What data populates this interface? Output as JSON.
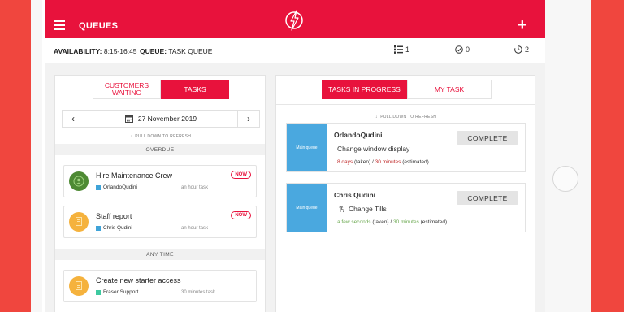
{
  "header": {
    "title": "QUEUES",
    "menu_icon": "hamburger-icon",
    "logo_icon": "lightning-bolt-logo-icon",
    "add_icon": "plus-icon"
  },
  "info": {
    "availability_label": "AVAILABILITY:",
    "availability_value": "8:15-16:45",
    "queue_label": "QUEUE:",
    "queue_value": "TASK QUEUE",
    "stats": [
      {
        "icon": "list-icon",
        "value": "1"
      },
      {
        "icon": "check-circle-icon",
        "value": "0"
      },
      {
        "icon": "clock-icon",
        "value": "2"
      }
    ]
  },
  "left_panel": {
    "tabs": [
      "CUSTOMERS WAITING",
      "TASKS"
    ],
    "active_tab": "TASKS",
    "date": "27 November 2019",
    "pull_refresh": "PULL DOWN TO REFRESH",
    "sections": {
      "overdue": "OVERDUE",
      "any_time": "ANY TIME"
    },
    "tasks": [
      {
        "title": "Hire Maintenance Crew",
        "assignee": "OrlandoQudini",
        "duration": "an hour task",
        "badge": "NOW",
        "icon": "person-icon",
        "color": "#4e8a34",
        "tag_color": "#3fa3d8"
      },
      {
        "title": "Staff report",
        "assignee": "Chris Qudini",
        "duration": "an hour task",
        "badge": "NOW",
        "icon": "document-icon",
        "color": "#f5b23d",
        "tag_color": "#3fa3d8"
      },
      {
        "title": "Create new starter access",
        "assignee": "Fraser Support",
        "duration": "30 minutes task",
        "badge": "",
        "icon": "document-icon",
        "color": "#f5b23d",
        "tag_color": "#3ec9a0"
      }
    ]
  },
  "right_panel": {
    "tabs": [
      "TASKS IN PROGRESS",
      "MY TASK"
    ],
    "active_tab": "TASKS IN PROGRESS",
    "pull_refresh": "PULL DOWN TO REFRESH",
    "cards": [
      {
        "queue": "Main queue",
        "name": "OrlandoQudini",
        "task": "Change window display",
        "time_value": "8 days",
        "time_mid": " (taken) / ",
        "estimate_value": "30 minutes",
        "time_end": " (estimated)",
        "button": "COMPLETE",
        "time_color": "red"
      },
      {
        "queue": "Main queue",
        "name": "Chris Qudini",
        "task": "Change Tills",
        "time_value": "a few seconds",
        "time_mid": " (taken) / ",
        "estimate_value": "30 minutes",
        "time_end": " (estimated)",
        "button": "COMPLETE",
        "time_color": "green"
      }
    ]
  },
  "colors": {
    "brand_red": "#e8123c",
    "queue_blue": "#4aa8df",
    "device_frame": "#f0463e"
  }
}
